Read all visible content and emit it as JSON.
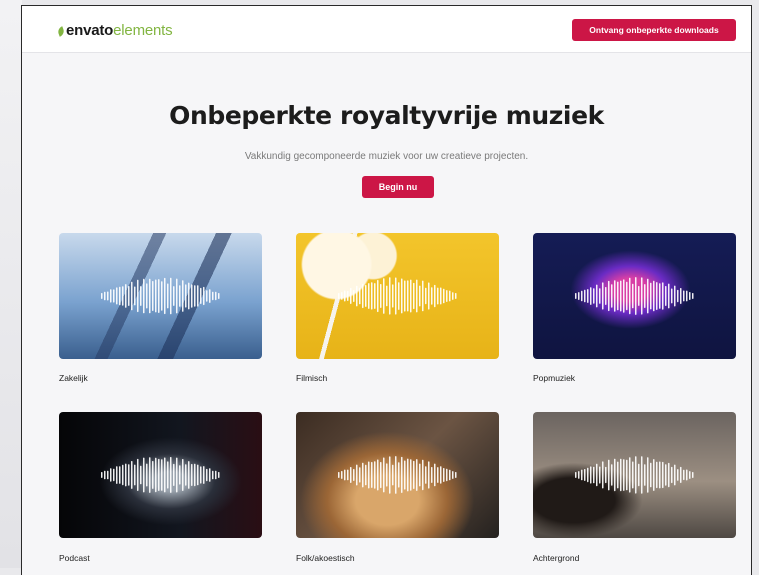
{
  "header": {
    "logo_bold": "envato",
    "logo_light": "elements",
    "cta": "Ontvang onbeperkte downloads"
  },
  "hero": {
    "title": "Onbeperkte royaltyvrije muziek",
    "subtitle": "Vakkundig gecomponeerde muziek voor uw creatieve projecten.",
    "cta": "Begin nu"
  },
  "categories": [
    {
      "label": "Zakelijk",
      "image": "city-buildings"
    },
    {
      "label": "Filmisch",
      "image": "popcorn"
    },
    {
      "label": "Popmuziek",
      "image": "headphones-woman"
    },
    {
      "label": "Podcast",
      "image": "microphone"
    },
    {
      "label": "Folk/akoestisch",
      "image": "acoustic-guitar"
    },
    {
      "label": "Achtergrond",
      "image": "cafe-barista"
    }
  ],
  "colors": {
    "accent": "#cc1646",
    "logo_green": "#82b541"
  }
}
